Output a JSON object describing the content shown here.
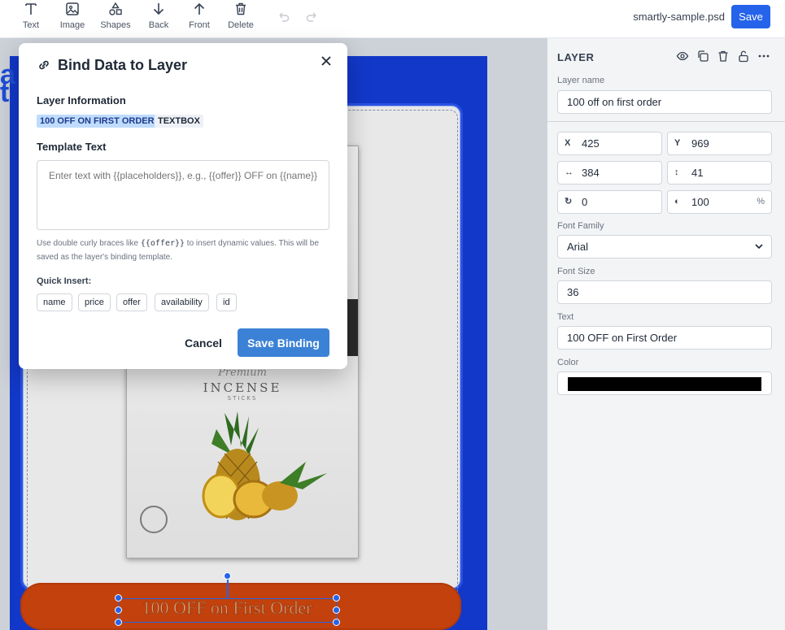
{
  "toolbar": {
    "tools": [
      {
        "label": "Text",
        "icon": "text-icon"
      },
      {
        "label": "Image",
        "icon": "image-icon"
      },
      {
        "label": "Shapes",
        "icon": "shapes-icon"
      },
      {
        "label": "Back",
        "icon": "arrow-down-icon"
      },
      {
        "label": "Front",
        "icon": "arrow-up-icon"
      },
      {
        "label": "Delete",
        "icon": "trash-icon"
      }
    ],
    "filename": "smartly-sample.psd",
    "save_label": "Save"
  },
  "canvas": {
    "banner_text": "100 OFF on First Order",
    "product_script": "Premium",
    "product_title": "INCENSE",
    "product_sub": "STICKS"
  },
  "modal": {
    "title": "Bind Data to Layer",
    "layer_info_label": "Layer Information",
    "layer_name_tag": "100 OFF ON FIRST ORDER",
    "layer_type_tag": "TEXTBOX",
    "template_label": "Template Text",
    "template_placeholder": "Enter text with {{placeholders}}, e.g., {{offer}} OFF on {{name}}",
    "help_before": "Use double curly braces like ",
    "help_code": "{{offer}}",
    "help_after": " to insert dynamic values. This will be saved as the layer's binding template.",
    "quick_insert_label": "Quick Insert:",
    "chips": [
      "name",
      "price",
      "offer",
      "availability",
      "id"
    ],
    "cancel_label": "Cancel",
    "save_label": "Save Binding"
  },
  "panel": {
    "title": "LAYER",
    "layer_name_label": "Layer name",
    "layer_name_value": "100 off on first order",
    "x_label": "X",
    "x_value": "425",
    "y_label": "Y",
    "y_value": "969",
    "w_value": "384",
    "h_value": "41",
    "rotation_value": "0",
    "opacity_value": "100",
    "opacity_unit": "%",
    "font_family_label": "Font Family",
    "font_family_value": "Arial",
    "font_size_label": "Font Size",
    "font_size_value": "36",
    "text_label": "Text",
    "text_value": "100 OFF on First Order",
    "color_label": "Color",
    "color_value": "#000000"
  },
  "colors": {
    "accent": "#2563eb",
    "save_binding": "#3b82d6",
    "banner": "#c2410c",
    "poster_blue": "#1238c9"
  }
}
